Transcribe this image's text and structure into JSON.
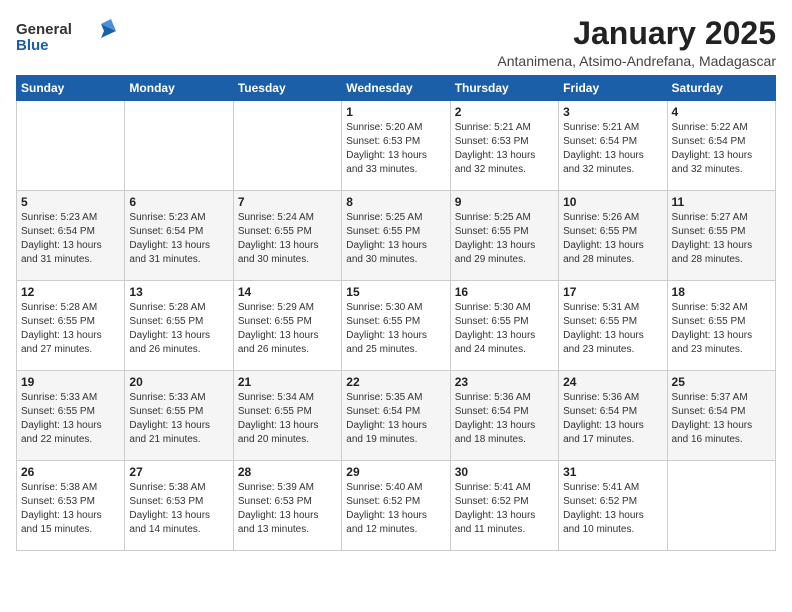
{
  "logo": {
    "line1": "General",
    "line2": "Blue"
  },
  "title": "January 2025",
  "subtitle": "Antanimena, Atsimo-Andrefana, Madagascar",
  "days_of_week": [
    "Sunday",
    "Monday",
    "Tuesday",
    "Wednesday",
    "Thursday",
    "Friday",
    "Saturday"
  ],
  "weeks": [
    [
      {
        "num": "",
        "sunrise": "",
        "sunset": "",
        "daylight": ""
      },
      {
        "num": "",
        "sunrise": "",
        "sunset": "",
        "daylight": ""
      },
      {
        "num": "",
        "sunrise": "",
        "sunset": "",
        "daylight": ""
      },
      {
        "num": "1",
        "sunrise": "Sunrise: 5:20 AM",
        "sunset": "Sunset: 6:53 PM",
        "daylight": "Daylight: 13 hours and 33 minutes."
      },
      {
        "num": "2",
        "sunrise": "Sunrise: 5:21 AM",
        "sunset": "Sunset: 6:53 PM",
        "daylight": "Daylight: 13 hours and 32 minutes."
      },
      {
        "num": "3",
        "sunrise": "Sunrise: 5:21 AM",
        "sunset": "Sunset: 6:54 PM",
        "daylight": "Daylight: 13 hours and 32 minutes."
      },
      {
        "num": "4",
        "sunrise": "Sunrise: 5:22 AM",
        "sunset": "Sunset: 6:54 PM",
        "daylight": "Daylight: 13 hours and 32 minutes."
      }
    ],
    [
      {
        "num": "5",
        "sunrise": "Sunrise: 5:23 AM",
        "sunset": "Sunset: 6:54 PM",
        "daylight": "Daylight: 13 hours and 31 minutes."
      },
      {
        "num": "6",
        "sunrise": "Sunrise: 5:23 AM",
        "sunset": "Sunset: 6:54 PM",
        "daylight": "Daylight: 13 hours and 31 minutes."
      },
      {
        "num": "7",
        "sunrise": "Sunrise: 5:24 AM",
        "sunset": "Sunset: 6:55 PM",
        "daylight": "Daylight: 13 hours and 30 minutes."
      },
      {
        "num": "8",
        "sunrise": "Sunrise: 5:25 AM",
        "sunset": "Sunset: 6:55 PM",
        "daylight": "Daylight: 13 hours and 30 minutes."
      },
      {
        "num": "9",
        "sunrise": "Sunrise: 5:25 AM",
        "sunset": "Sunset: 6:55 PM",
        "daylight": "Daylight: 13 hours and 29 minutes."
      },
      {
        "num": "10",
        "sunrise": "Sunrise: 5:26 AM",
        "sunset": "Sunset: 6:55 PM",
        "daylight": "Daylight: 13 hours and 28 minutes."
      },
      {
        "num": "11",
        "sunrise": "Sunrise: 5:27 AM",
        "sunset": "Sunset: 6:55 PM",
        "daylight": "Daylight: 13 hours and 28 minutes."
      }
    ],
    [
      {
        "num": "12",
        "sunrise": "Sunrise: 5:28 AM",
        "sunset": "Sunset: 6:55 PM",
        "daylight": "Daylight: 13 hours and 27 minutes."
      },
      {
        "num": "13",
        "sunrise": "Sunrise: 5:28 AM",
        "sunset": "Sunset: 6:55 PM",
        "daylight": "Daylight: 13 hours and 26 minutes."
      },
      {
        "num": "14",
        "sunrise": "Sunrise: 5:29 AM",
        "sunset": "Sunset: 6:55 PM",
        "daylight": "Daylight: 13 hours and 26 minutes."
      },
      {
        "num": "15",
        "sunrise": "Sunrise: 5:30 AM",
        "sunset": "Sunset: 6:55 PM",
        "daylight": "Daylight: 13 hours and 25 minutes."
      },
      {
        "num": "16",
        "sunrise": "Sunrise: 5:30 AM",
        "sunset": "Sunset: 6:55 PM",
        "daylight": "Daylight: 13 hours and 24 minutes."
      },
      {
        "num": "17",
        "sunrise": "Sunrise: 5:31 AM",
        "sunset": "Sunset: 6:55 PM",
        "daylight": "Daylight: 13 hours and 23 minutes."
      },
      {
        "num": "18",
        "sunrise": "Sunrise: 5:32 AM",
        "sunset": "Sunset: 6:55 PM",
        "daylight": "Daylight: 13 hours and 23 minutes."
      }
    ],
    [
      {
        "num": "19",
        "sunrise": "Sunrise: 5:33 AM",
        "sunset": "Sunset: 6:55 PM",
        "daylight": "Daylight: 13 hours and 22 minutes."
      },
      {
        "num": "20",
        "sunrise": "Sunrise: 5:33 AM",
        "sunset": "Sunset: 6:55 PM",
        "daylight": "Daylight: 13 hours and 21 minutes."
      },
      {
        "num": "21",
        "sunrise": "Sunrise: 5:34 AM",
        "sunset": "Sunset: 6:55 PM",
        "daylight": "Daylight: 13 hours and 20 minutes."
      },
      {
        "num": "22",
        "sunrise": "Sunrise: 5:35 AM",
        "sunset": "Sunset: 6:54 PM",
        "daylight": "Daylight: 13 hours and 19 minutes."
      },
      {
        "num": "23",
        "sunrise": "Sunrise: 5:36 AM",
        "sunset": "Sunset: 6:54 PM",
        "daylight": "Daylight: 13 hours and 18 minutes."
      },
      {
        "num": "24",
        "sunrise": "Sunrise: 5:36 AM",
        "sunset": "Sunset: 6:54 PM",
        "daylight": "Daylight: 13 hours and 17 minutes."
      },
      {
        "num": "25",
        "sunrise": "Sunrise: 5:37 AM",
        "sunset": "Sunset: 6:54 PM",
        "daylight": "Daylight: 13 hours and 16 minutes."
      }
    ],
    [
      {
        "num": "26",
        "sunrise": "Sunrise: 5:38 AM",
        "sunset": "Sunset: 6:53 PM",
        "daylight": "Daylight: 13 hours and 15 minutes."
      },
      {
        "num": "27",
        "sunrise": "Sunrise: 5:38 AM",
        "sunset": "Sunset: 6:53 PM",
        "daylight": "Daylight: 13 hours and 14 minutes."
      },
      {
        "num": "28",
        "sunrise": "Sunrise: 5:39 AM",
        "sunset": "Sunset: 6:53 PM",
        "daylight": "Daylight: 13 hours and 13 minutes."
      },
      {
        "num": "29",
        "sunrise": "Sunrise: 5:40 AM",
        "sunset": "Sunset: 6:52 PM",
        "daylight": "Daylight: 13 hours and 12 minutes."
      },
      {
        "num": "30",
        "sunrise": "Sunrise: 5:41 AM",
        "sunset": "Sunset: 6:52 PM",
        "daylight": "Daylight: 13 hours and 11 minutes."
      },
      {
        "num": "31",
        "sunrise": "Sunrise: 5:41 AM",
        "sunset": "Sunset: 6:52 PM",
        "daylight": "Daylight: 13 hours and 10 minutes."
      },
      {
        "num": "",
        "sunrise": "",
        "sunset": "",
        "daylight": ""
      }
    ]
  ]
}
